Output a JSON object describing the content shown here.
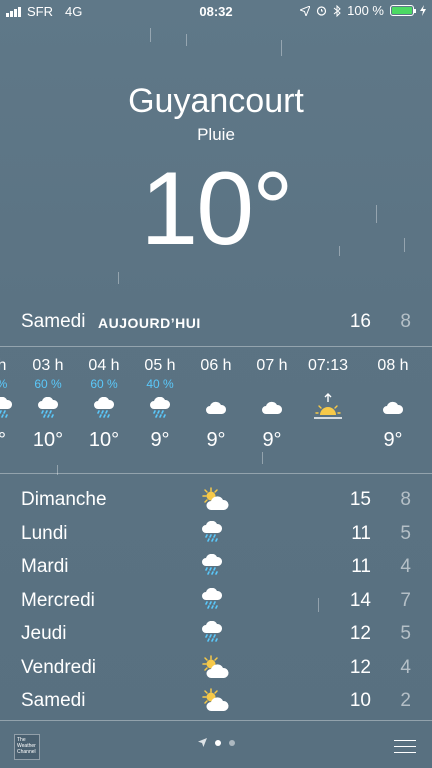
{
  "status": {
    "carrier": "SFR",
    "network": "4G",
    "time": "08:32",
    "battery": "100 %",
    "battery_fraction": 1.0
  },
  "location": {
    "city": "Guyancourt",
    "condition": "Pluie",
    "temperature": "10°"
  },
  "today": {
    "day": "Samedi",
    "tag": "AUJOURD’HUI",
    "high": "16",
    "low": "8"
  },
  "hourly": [
    {
      "label": "h",
      "pct": "%",
      "icon": "rain-cloud-icon",
      "temp": "°"
    },
    {
      "label": "03 h",
      "pct": "60 %",
      "icon": "rain-cloud-icon",
      "temp": "10°"
    },
    {
      "label": "04 h",
      "pct": "60 %",
      "icon": "rain-cloud-icon",
      "temp": "10°"
    },
    {
      "label": "05 h",
      "pct": "40 %",
      "icon": "rain-cloud-icon",
      "temp": "9°"
    },
    {
      "label": "06 h",
      "pct": "",
      "icon": "cloud-icon",
      "temp": "9°"
    },
    {
      "label": "07 h",
      "pct": "",
      "icon": "cloud-icon",
      "temp": "9°"
    },
    {
      "label": "07:13",
      "pct": "",
      "icon": "sunrise-icon",
      "temp": ""
    },
    {
      "label": "08 h",
      "pct": "",
      "icon": "cloud-icon",
      "temp": "9°"
    }
  ],
  "daily": [
    {
      "day": "Dimanche",
      "icon": "sun-cloud-icon",
      "high": "15",
      "low": "8"
    },
    {
      "day": "Lundi",
      "icon": "rain-cloud-icon",
      "high": "11",
      "low": "5"
    },
    {
      "day": "Mardi",
      "icon": "rain-cloud-icon",
      "high": "11",
      "low": "4"
    },
    {
      "day": "Mercredi",
      "icon": "rain-cloud-icon",
      "high": "14",
      "low": "7"
    },
    {
      "day": "Jeudi",
      "icon": "rain-cloud-icon",
      "high": "12",
      "low": "5"
    },
    {
      "day": "Vendredi",
      "icon": "sun-cloud-icon",
      "high": "12",
      "low": "4"
    },
    {
      "day": "Samedi",
      "icon": "sun-cloud-icon",
      "high": "10",
      "low": "2"
    }
  ],
  "footer": {
    "twc_logo": "The Weather Channel"
  },
  "colors": {
    "precip": "#5ac8fa",
    "battery": "#4cd964",
    "sun": "#f7c948"
  }
}
